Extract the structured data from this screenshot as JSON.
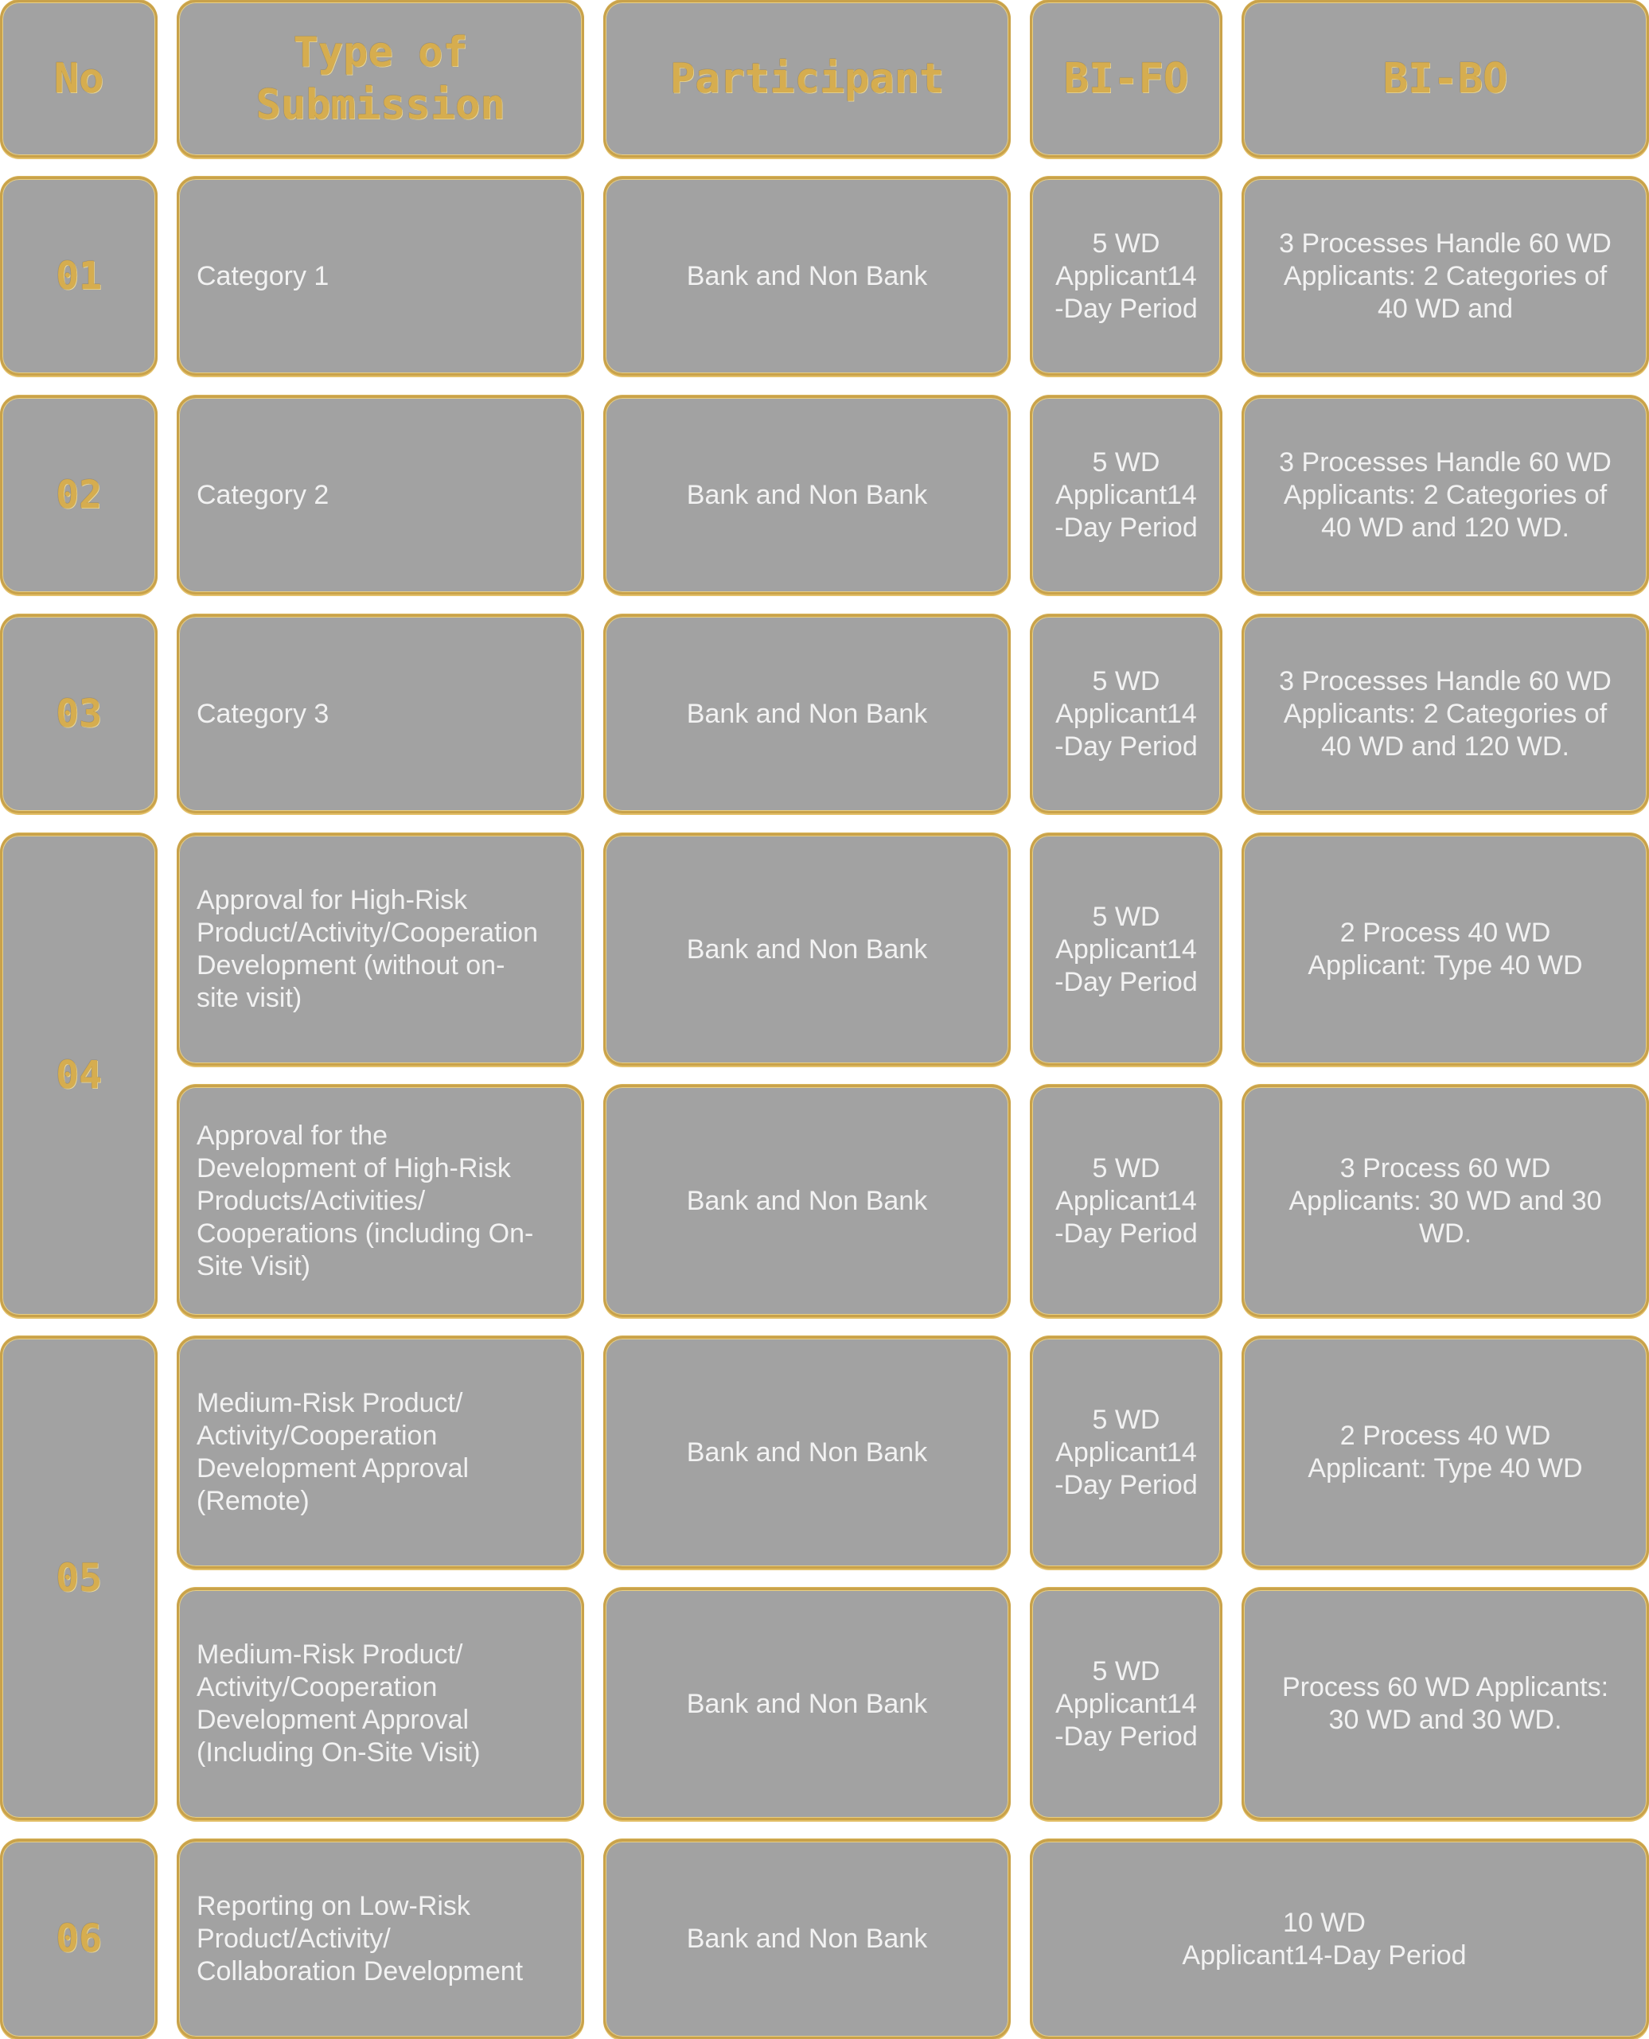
{
  "headers": [
    "No",
    "Type of\nSubmission",
    "Participant",
    "BI-FO",
    "BI-BO"
  ],
  "rows": [
    {
      "no": "01",
      "submission": "Category 1",
      "participant": "Bank and Non Bank",
      "bifo": "5 WD\nApplicant14\n-Day Period",
      "bibo": "3 Processes Handle 60 WD\nApplicants: 2 Categories of\n40 WD and"
    },
    {
      "no": "02",
      "submission": "Category 2",
      "participant": "Bank and Non Bank",
      "bifo": "5 WD\nApplicant14\n-Day Period",
      "bibo": "3 Processes Handle 60 WD\nApplicants: 2 Categories of\n40 WD and 120 WD."
    },
    {
      "no": "03",
      "submission": "Category 3",
      "participant": "Bank and Non Bank",
      "bifo": "5 WD\nApplicant14\n-Day Period",
      "bibo": "3 Processes Handle 60 WD\nApplicants: 2 Categories of\n40 WD and 120 WD."
    },
    {
      "no": "04",
      "submission": "Approval for High-Risk\nProduct/Activity/Cooperation\nDevelopment (without on-\nsite visit)",
      "participant": "Bank and Non Bank",
      "bifo": "5 WD\nApplicant14\n-Day Period",
      "bibo": "2 Process 40 WD\nApplicant: Type 40 WD"
    },
    {
      "no": "",
      "submission": "Approval for the\nDevelopment of High-Risk\nProducts/Activities/\nCooperations (including On-\nSite Visit)",
      "participant": "Bank and Non Bank",
      "bifo": "5 WD\nApplicant14\n-Day Period",
      "bibo": "3 Process 60 WD\nApplicants: 30 WD and 30\nWD."
    },
    {
      "no": "05",
      "submission": "Medium-Risk Product/\nActivity/Cooperation\nDevelopment Approval\n(Remote)",
      "participant": "Bank and Non Bank",
      "bifo": "5 WD\nApplicant14\n-Day Period",
      "bibo": "2 Process 40 WD\nApplicant: Type 40 WD"
    },
    {
      "no": "",
      "submission": "Medium-Risk Product/\nActivity/Cooperation\nDevelopment Approval\n(Including On-Site Visit)",
      "participant": "Bank and Non Bank",
      "bifo": "5 WD\nApplicant14\n-Day Period",
      "bibo": "Process 60 WD Applicants:\n30 WD and 30 WD."
    },
    {
      "no": "06",
      "submission": "Reporting on Low-Risk\nProduct/Activity/\nCollaboration Development",
      "participant": "Bank and Non Bank",
      "bifo_bibo": "10  WD\nApplicant14-Day Period"
    }
  ]
}
